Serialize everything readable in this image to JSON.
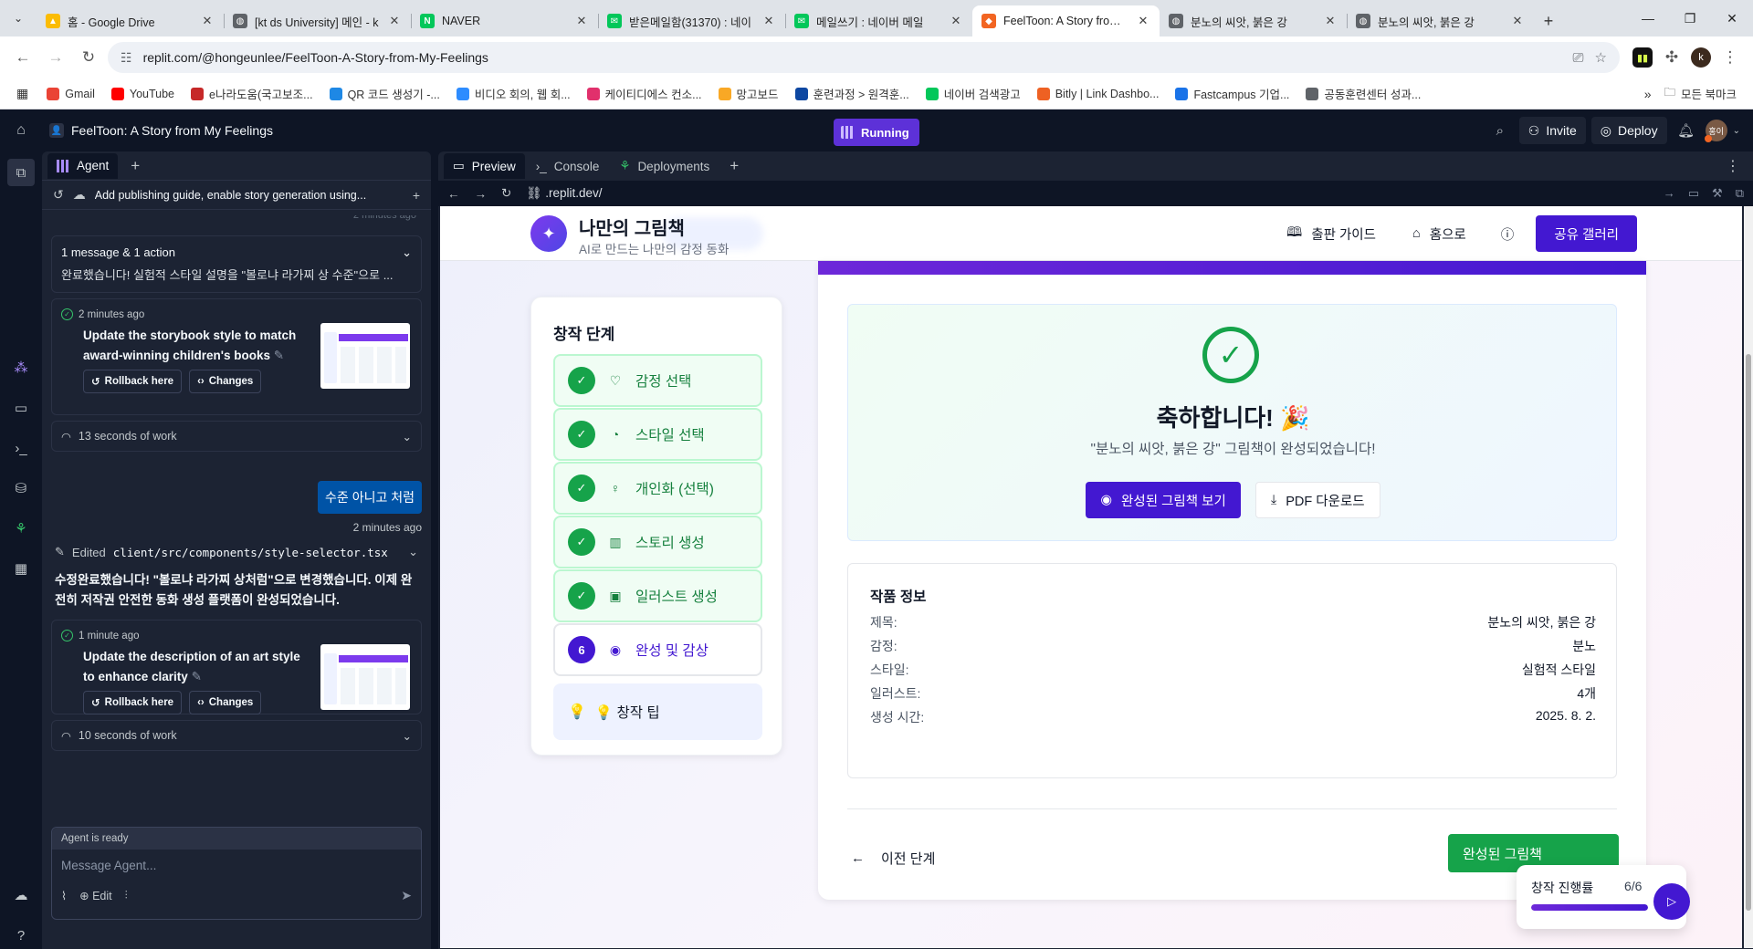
{
  "browser": {
    "tabs": [
      {
        "title": "홈 - Google Drive",
        "fav_color": "#fbbc04",
        "fav_glyph": "▲"
      },
      {
        "title": "[kt ds University] 메인 - k",
        "fav_color": "#5f6368",
        "fav_glyph": "◍"
      },
      {
        "title": "NAVER",
        "fav_color": "#03c75a",
        "fav_glyph": "N"
      },
      {
        "title": "받은메일함(31370) : 네이",
        "fav_color": "#03c75a",
        "fav_glyph": "✉"
      },
      {
        "title": "메일쓰기 : 네이버 메일",
        "fav_color": "#03c75a",
        "fav_glyph": "✉"
      },
      {
        "title": "FeelToon: A Story from M",
        "fav_color": "#f26522",
        "fav_glyph": "◆",
        "active": true
      },
      {
        "title": "분노의 씨앗, 붉은 강",
        "fav_color": "#5f6368",
        "fav_glyph": "◍"
      },
      {
        "title": "분노의 씨앗, 붉은 강",
        "fav_color": "#5f6368",
        "fav_glyph": "◍"
      }
    ],
    "url": "replit.com/@hongeunlee/FeelToon-A-Story-from-My-Feelings",
    "profile_initial": "k",
    "bookmarks": [
      {
        "label": "Gmail",
        "color": "#ea4335"
      },
      {
        "label": "YouTube",
        "color": "#ff0000"
      },
      {
        "label": "e나라도움(국고보조...",
        "color": "#c62828"
      },
      {
        "label": "QR 코드 생성기 -...",
        "color": "#1e88e5"
      },
      {
        "label": "비디오 회의, 웹 회...",
        "color": "#2d8cff"
      },
      {
        "label": "케이티디에스 컨소...",
        "color": "#e1306c"
      },
      {
        "label": "망고보드",
        "color": "#f9a825"
      },
      {
        "label": "훈련과정 > 원격훈...",
        "color": "#0d47a1"
      },
      {
        "label": "네이버 검색광고",
        "color": "#03c75a"
      },
      {
        "label": "Bitly | Link Dashbo...",
        "color": "#ee6123"
      },
      {
        "label": "Fastcampus 기업...",
        "color": "#1a73e8"
      },
      {
        "label": "공동훈련센터 성과...",
        "color": "#5f6368"
      }
    ],
    "bookmarks_folder": "모든 북마크"
  },
  "replit": {
    "repl_name": "FeelToon: A Story from My Feelings",
    "run_status": "Running",
    "invite_label": "Invite",
    "deploy_label": "Deploy",
    "user_avatar_text": "홍이",
    "agent": {
      "tab_label": "Agent",
      "chat_title": "Add publishing guide, enable story generation using...",
      "ghost_time": "2 minutes ago",
      "summary_head": "1 message & 1 action",
      "summary_text": "완료했습니다! 실험적 스타일 설명을 \"볼로냐 라가찌 상 수준\"으로 ...",
      "checkpoints": [
        {
          "time": "2 minutes ago",
          "title": "Update the storybook style to match award-winning children's books"
        },
        {
          "time": "1 minute ago",
          "title": "Update the description of an art style to enhance clarity"
        }
      ],
      "rollback_label": "Rollback here",
      "changes_label": "Changes",
      "work_rows": [
        "13 seconds of work",
        "10 seconds of work"
      ],
      "user_message": "수준 아니고 처럼",
      "user_message_time": "2 minutes ago",
      "edited_prefix": "Edited",
      "edited_file": "client/src/components/style-selector.tsx",
      "reply": "수정완료했습니다! \"볼로냐 라가찌 상처럼\"으로 변경했습니다. 이제 완전히 저작권 안전한 동화 생성 플랫폼이 완성되었습니다.",
      "input_status": "Agent is ready",
      "input_placeholder": "Message Agent...",
      "edit_label": "Edit"
    },
    "workspace": {
      "tabs": [
        "Preview",
        "Console",
        "Deployments"
      ],
      "preview_url": ".replit.dev/"
    }
  },
  "site": {
    "title": "나만의 그림책",
    "subtitle": "AI로 만드는 나만의 감정 동화",
    "nav": {
      "guide": "출판 가이드",
      "home": "홈으로",
      "gallery": "공유 갤러리"
    },
    "steps_title": "창작 단계",
    "steps": [
      {
        "label": "감정 선택",
        "icon": "♡",
        "status": "done"
      },
      {
        "label": "스타일 선택",
        "icon": "◔",
        "status": "done"
      },
      {
        "label": "개인화 (선택)",
        "icon": "♀",
        "status": "done"
      },
      {
        "label": "스토리 생성",
        "icon": "▥",
        "status": "done"
      },
      {
        "label": "일러스트 생성",
        "icon": "▣",
        "status": "done"
      },
      {
        "label": "완성 및 감상",
        "icon": "◉",
        "status": "current",
        "number": "6"
      }
    ],
    "tip_label": "💡 창작 팁",
    "congrats_title": "축하합니다! 🎉",
    "congrats_sub": "\"분노의 씨앗, 붉은 강\" 그림책이 완성되었습니다!",
    "view_book_label": "완성된 그림책 보기",
    "pdf_label": "PDF 다운로드",
    "info_title": "작품 정보",
    "info_rows": [
      {
        "k": "제목:",
        "v": "분노의 씨앗, 붉은 강"
      },
      {
        "k": "감정:",
        "v": "분노"
      },
      {
        "k": "스타일:",
        "v": "실험적 스타일"
      },
      {
        "k": "일러스트:",
        "v": "4개"
      },
      {
        "k": "생성 시간:",
        "v": "2025. 8. 2."
      }
    ],
    "prev_label": "이전 단계",
    "final_label": "완성된 그림책",
    "progress_label": "창작 진행률",
    "progress_count": "6/6",
    "progress_fraction": 1.0
  }
}
